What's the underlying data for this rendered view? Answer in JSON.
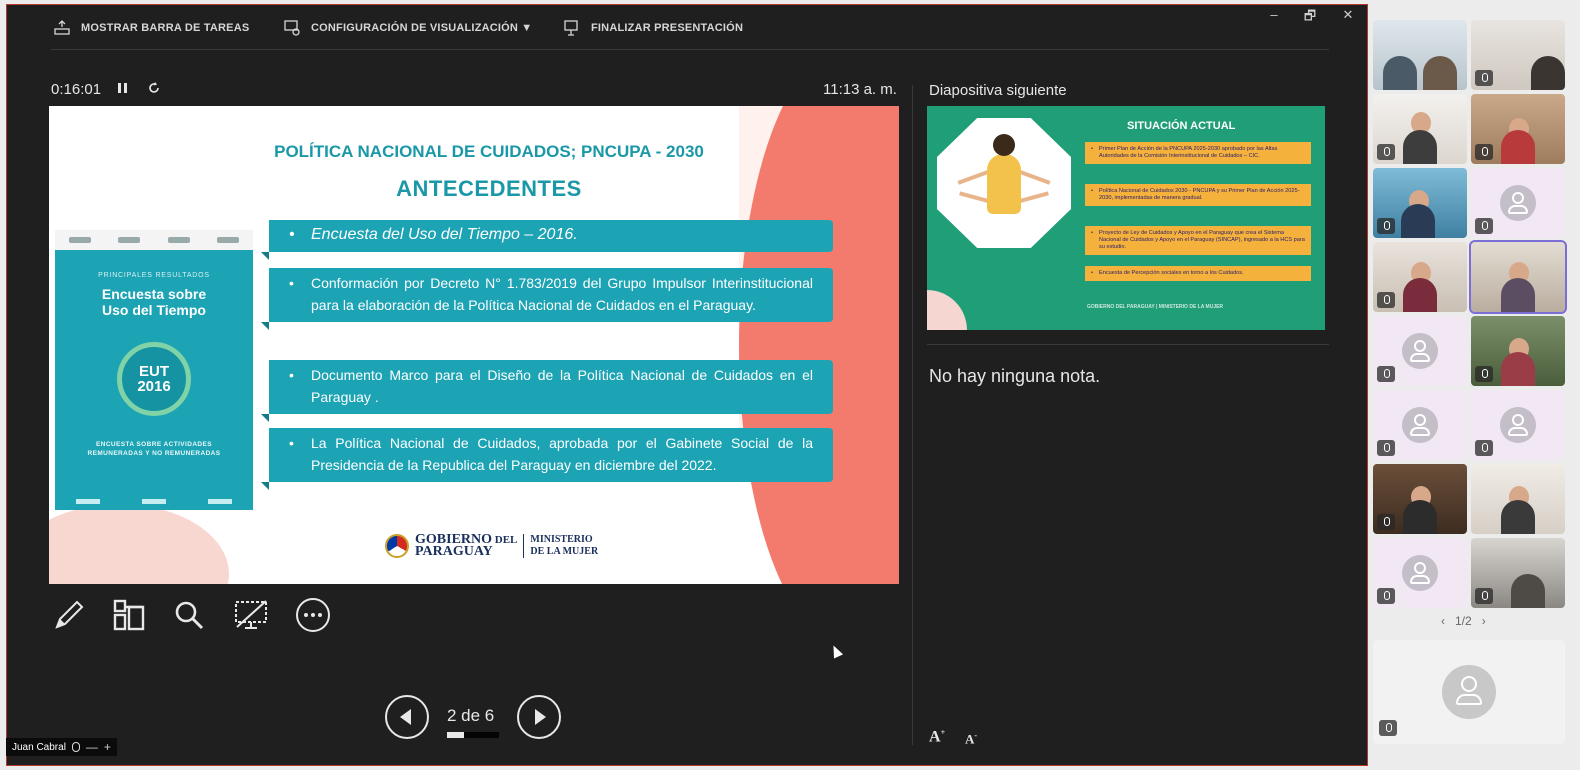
{
  "toolbar": {
    "show_taskbar": "MOSTRAR BARRA DE TAREAS",
    "display_settings": "CONFIGURACIÓN DE VISUALIZACIÓN ▼",
    "end_presentation": "FINALIZAR PRESENTACIÓN"
  },
  "window_controls": {
    "minimize": "–",
    "restore": "🗗",
    "close": "✕"
  },
  "presenter": {
    "elapsed": "0:16:01",
    "pause_icon": "pause-icon",
    "restart_icon": "restart-icon",
    "clock": "11:13 a. m."
  },
  "slide": {
    "title": "POLÍTICA NACIONAL DE CUIDADOS; PNCUPA - 2030",
    "subtitle": "ANTECEDENTES",
    "cover": {
      "kicker": "PRINCIPALES RESULTADOS",
      "title_line1": "Encuesta sobre",
      "title_line2": "Uso del Tiempo",
      "badge_line1": "EUT",
      "badge_line2": "2016",
      "caption_line1": "ENCUESTA SOBRE ACTIVIDADES",
      "caption_line2": "REMUNERADAS Y NO REMUNERADAS"
    },
    "bullets": [
      "Encuesta del Uso del Tiempo – 2016.",
      "Conformación por Decreto N° 1.783/2019 del Grupo Impulsor Interinstitucional para la elaboración de la Política Nacional de Cuidados en el Paraguay.",
      "Documento Marco para el Diseño de la Política Nacional de Cuidados en el Paraguay .",
      "La Política Nacional de Cuidados, aprobada por el Gabinete Social de la Presidencia de la Republica del Paraguay en diciembre del 2022."
    ],
    "logo": {
      "gobierno": "GOBIERNO",
      "del": "DEL",
      "paraguay": "PARAGUAY",
      "ministerio": "MINISTERIO",
      "mujer": "DE LA MUJER"
    }
  },
  "tools": [
    "pen-icon",
    "slides-grid-icon",
    "zoom-icon",
    "screen-off-icon",
    "more-options-icon"
  ],
  "navigation": {
    "page_label": "2 de 6",
    "current": 2,
    "total": 6
  },
  "next_slide": {
    "label": "Diapositiva siguiente",
    "title": "SITUACIÓN ACTUAL",
    "items": [
      "Primer Plan de Acción de la PNCUPA 2025-2030 aprobado por las Altas Autoridades de la Comisión Interinstitucional de Cuidados – CIC.",
      "Política Nacional de Cuidados 2030 - PNCUPA y su Primer Plan de Acción 2025-2030, implementadas de manera gradual.",
      "Proyecto de Ley de Cuidados y Apoyo en el Paraguay que crea el Sistema Nacional de Cuidados y Apoyo en el Paraguay (SINCAP), ingresado a la HCS para su estudio.",
      "Encuesta de Percepción sociales en torno a los Cuidados."
    ],
    "footer": "GOBIERNO DEL PARAGUAY | MINISTERIO DE LA MUJER"
  },
  "notes": {
    "text": "No hay ninguna nota.",
    "increase_font": "A",
    "decrease_font": "A"
  },
  "speaker": {
    "name": "Juan Cabral",
    "minus": "—",
    "plus": "+"
  },
  "participants": {
    "pager": "1/2",
    "prev": "‹",
    "next": "›"
  }
}
